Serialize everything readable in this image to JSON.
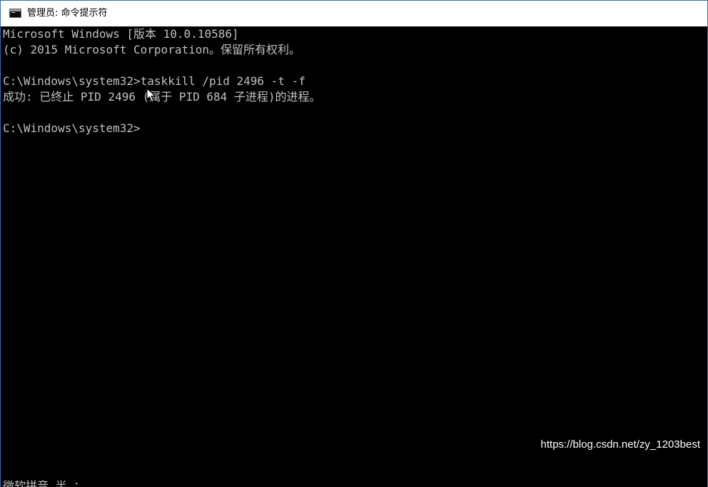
{
  "window": {
    "title": "管理员: 命令提示符",
    "icon": "cmd-icon"
  },
  "console": {
    "lines": [
      "Microsoft Windows [版本 10.0.10586]",
      "(c) 2015 Microsoft Corporation。保留所有权利。",
      "",
      "C:\\Windows\\system32>taskkill /pid 2496 -t -f",
      "成功: 已终止 PID 2496 (属于 PID 684 子进程)的进程。",
      "",
      "C:\\Windows\\system32>"
    ],
    "ime_status": "微软拼音 半 ："
  },
  "watermark": "https://blog.csdn.net/zy_1203best",
  "colors": {
    "console_bg": "#000000",
    "console_fg": "#c0c0c0",
    "titlebar_bg": "#ffffff",
    "border": "#2b6fb8"
  }
}
